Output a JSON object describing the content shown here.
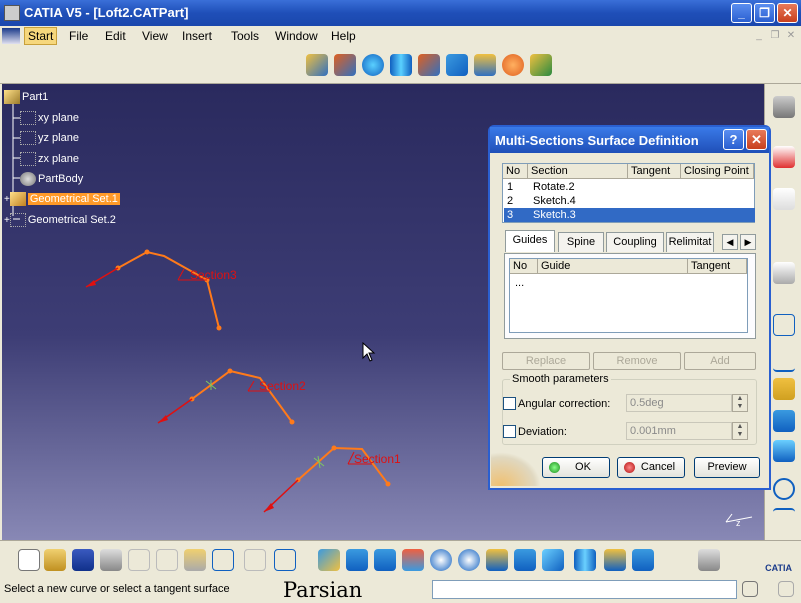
{
  "window": {
    "title": "CATIA V5 - [Loft2.CATPart]",
    "minimize": "_",
    "restore": "❐",
    "close": "✕"
  },
  "menu": {
    "items": [
      "Start",
      "File",
      "Edit",
      "View",
      "Insert",
      "Tools",
      "Window",
      "Help"
    ]
  },
  "tree": {
    "nodes": [
      {
        "label": "Part1",
        "icon": "part-icon"
      },
      {
        "label": "xy plane",
        "icon": "plane-icon"
      },
      {
        "label": "yz plane",
        "icon": "plane-icon"
      },
      {
        "label": "zx plane",
        "icon": "plane-icon"
      },
      {
        "label": "PartBody",
        "icon": "body-icon"
      },
      {
        "label": "Geometrical Set.1",
        "icon": "geoset-icon",
        "selected": true
      },
      {
        "label": "Geometrical Set.2",
        "icon": "geoset-icon"
      }
    ]
  },
  "viewport": {
    "sections": [
      "Section3",
      "Section2",
      "Section1"
    ],
    "colors": {
      "curve": "#ff7a1a",
      "label": "#e01010",
      "arrow": "#e01010"
    }
  },
  "dialog": {
    "title": "Multi-Sections Surface Definition",
    "help": "?",
    "close": "✕",
    "sections_table": {
      "headers": [
        "No",
        "Section",
        "Tangent",
        "Closing Point"
      ],
      "rows": [
        {
          "no": "1",
          "section": "Rotate.2",
          "selected": false
        },
        {
          "no": "2",
          "section": "Sketch.4",
          "selected": false
        },
        {
          "no": "3",
          "section": "Sketch.3",
          "selected": true
        }
      ]
    },
    "tabs": [
      "Guides",
      "Spine",
      "Coupling",
      "Relimitat"
    ],
    "active_tab": "Guides",
    "guides_table": {
      "headers": [
        "No",
        "Guide",
        "Tangent"
      ],
      "rows": [
        {
          "no": "...",
          "guide": ""
        }
      ]
    },
    "buttons": {
      "replace": "Replace",
      "remove": "Remove",
      "add": "Add"
    },
    "smooth": {
      "label": "Smooth parameters",
      "angular_label": "Angular correction:",
      "angular_value": "0.5deg",
      "deviation_label": "Deviation:",
      "deviation_value": "0.001mm"
    },
    "ok": "OK",
    "cancel": "Cancel",
    "preview": "Preview"
  },
  "status": {
    "text": "Select a new curve or select a tangent surface",
    "brand": "Parsian",
    "command_value": ""
  }
}
